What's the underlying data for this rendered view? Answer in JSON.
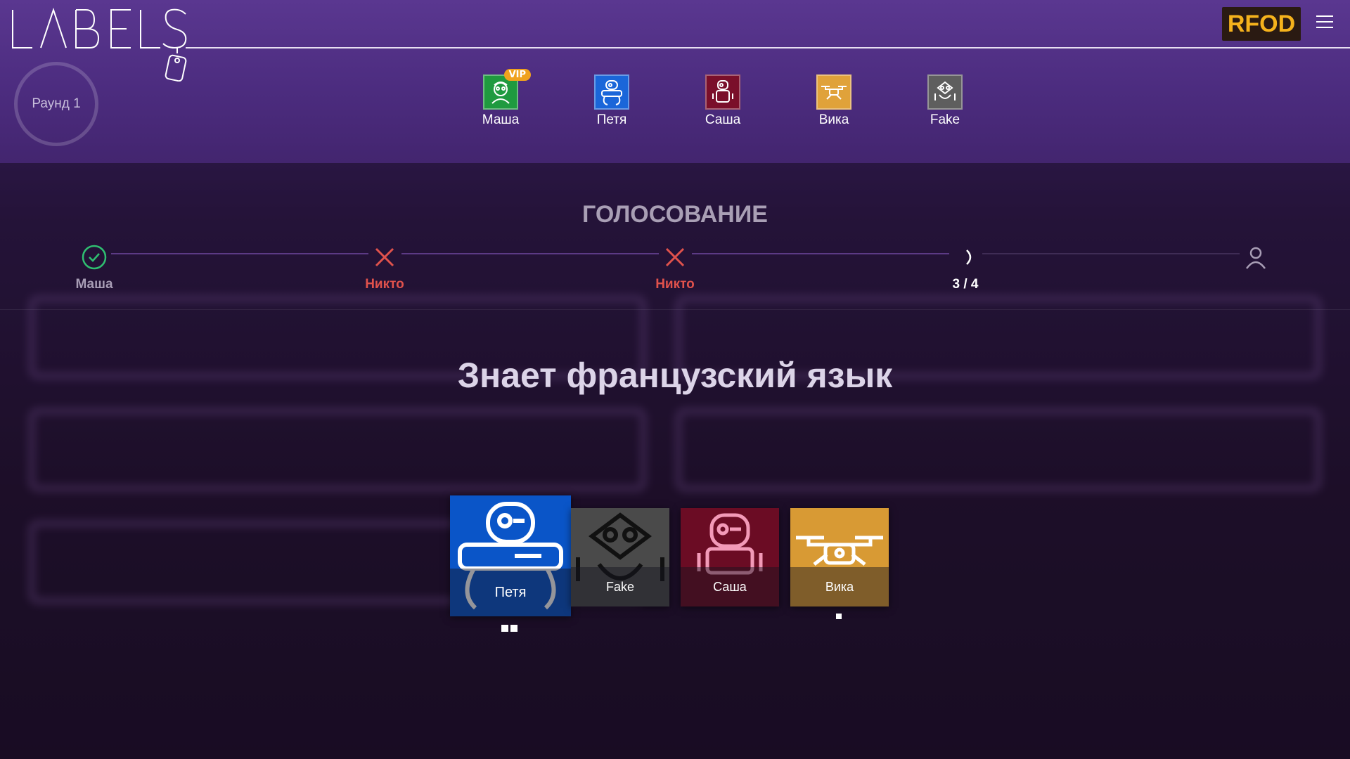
{
  "app": {
    "logo_text": "LABELS",
    "brand": "RFOD"
  },
  "round": {
    "label": "Раунд 1"
  },
  "players": [
    {
      "name": "Маша",
      "color": "#1f9a3f",
      "vip": "VIP",
      "icon": "robot-girl-icon"
    },
    {
      "name": "Петя",
      "color": "#1a66d9",
      "icon": "robot-walker-icon"
    },
    {
      "name": "Саша",
      "color": "#7a0f2a",
      "icon": "robot-tall-icon"
    },
    {
      "name": "Вика",
      "color": "#e0a23a",
      "icon": "drone-icon"
    },
    {
      "name": "Fake",
      "color": "#5e5e5e",
      "icon": "robot-crab-icon"
    }
  ],
  "voting": {
    "title": "ГОЛОСОВАНИЕ",
    "steps": [
      {
        "status": "done",
        "label": "Маша",
        "color": "#a89db5"
      },
      {
        "status": "fail",
        "label": "Никто",
        "color": "#e0524c"
      },
      {
        "status": "fail",
        "label": "Никто",
        "color": "#e0524c"
      },
      {
        "status": "progress",
        "label": "3 / 4",
        "color": "#ffffff"
      },
      {
        "status": "pending",
        "label": "",
        "color": "#a89db5"
      }
    ]
  },
  "question": "Знает французский язык",
  "candidates": [
    {
      "name": "Петя",
      "color": "#0a55c8",
      "votes": 2,
      "selected": true,
      "icon": "robot-walker-icon"
    },
    {
      "name": "Fake",
      "color": "#4a4a4a",
      "votes": 0,
      "selected": false,
      "icon": "robot-crab-icon"
    },
    {
      "name": "Саша",
      "color": "#6b0c24",
      "votes": 0,
      "selected": false,
      "icon": "robot-tall-icon"
    },
    {
      "name": "Вика",
      "color": "#d89a34",
      "votes": 1,
      "selected": false,
      "icon": "drone-icon"
    }
  ]
}
